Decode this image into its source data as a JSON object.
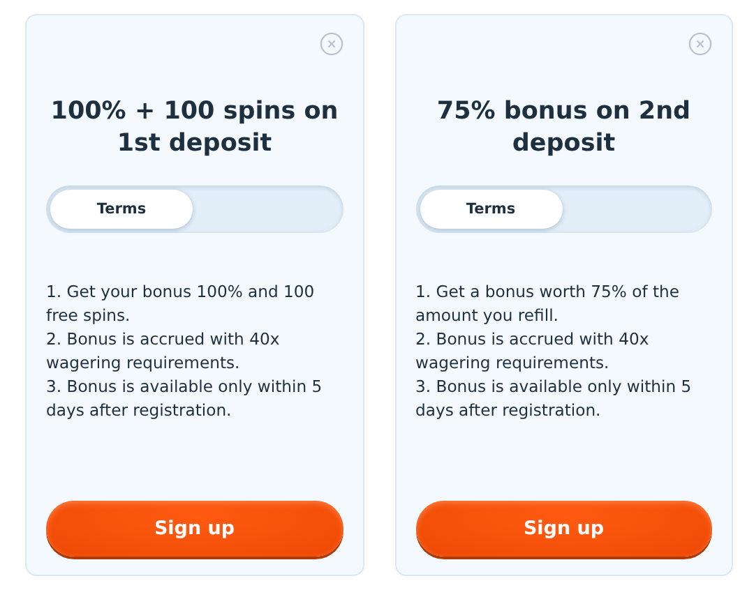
{
  "offers": [
    {
      "title": "100% + 100 spins on 1st deposit",
      "tabs": [
        {
          "label": "Terms",
          "selected": true
        }
      ],
      "terms": [
        "1. Get your bonus 100% and 100 free spins.",
        "2. Bonus is accrued with 40x wagering requirements.",
        "3. Bonus is available only within 5 days after registration."
      ],
      "button": "Sign up"
    },
    {
      "title": "75% bonus on 2nd deposit",
      "tabs": [
        {
          "label": "Terms",
          "selected": true
        }
      ],
      "terms": [
        "1. Get a bonus worth 75% of the amount you refill.",
        "2. Bonus is accrued with 40x wagering requirements.",
        "3. Bonus is available only within 5 days after registration."
      ],
      "button": "Sign up"
    }
  ]
}
